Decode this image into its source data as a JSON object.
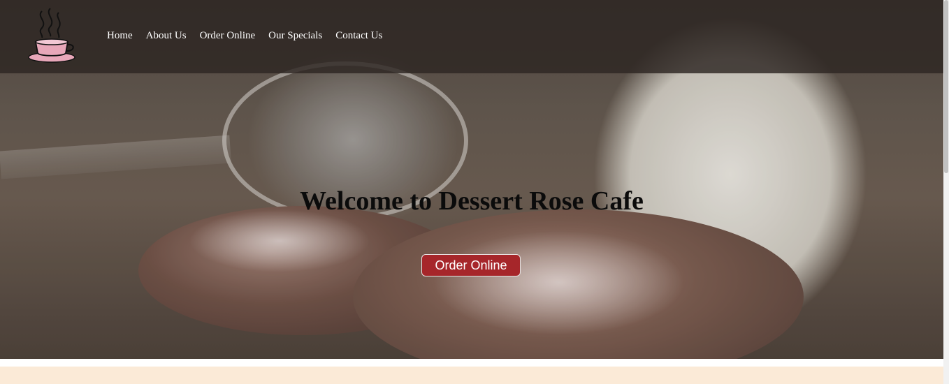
{
  "brand": {
    "logo_icon": "teacup-logo-icon",
    "cup_color": "#e8a7b9"
  },
  "nav": {
    "items": [
      {
        "label": "Home"
      },
      {
        "label": "About Us"
      },
      {
        "label": "Order Online"
      },
      {
        "label": "Our Specials"
      },
      {
        "label": "Contact Us"
      }
    ]
  },
  "hero": {
    "title": "Welcome to Dessert Rose Cafe",
    "cta_label": "Order Online",
    "cta_color": "#a6262a"
  },
  "colors": {
    "nav_bg": "#2d2622",
    "band": "#fbead7"
  }
}
